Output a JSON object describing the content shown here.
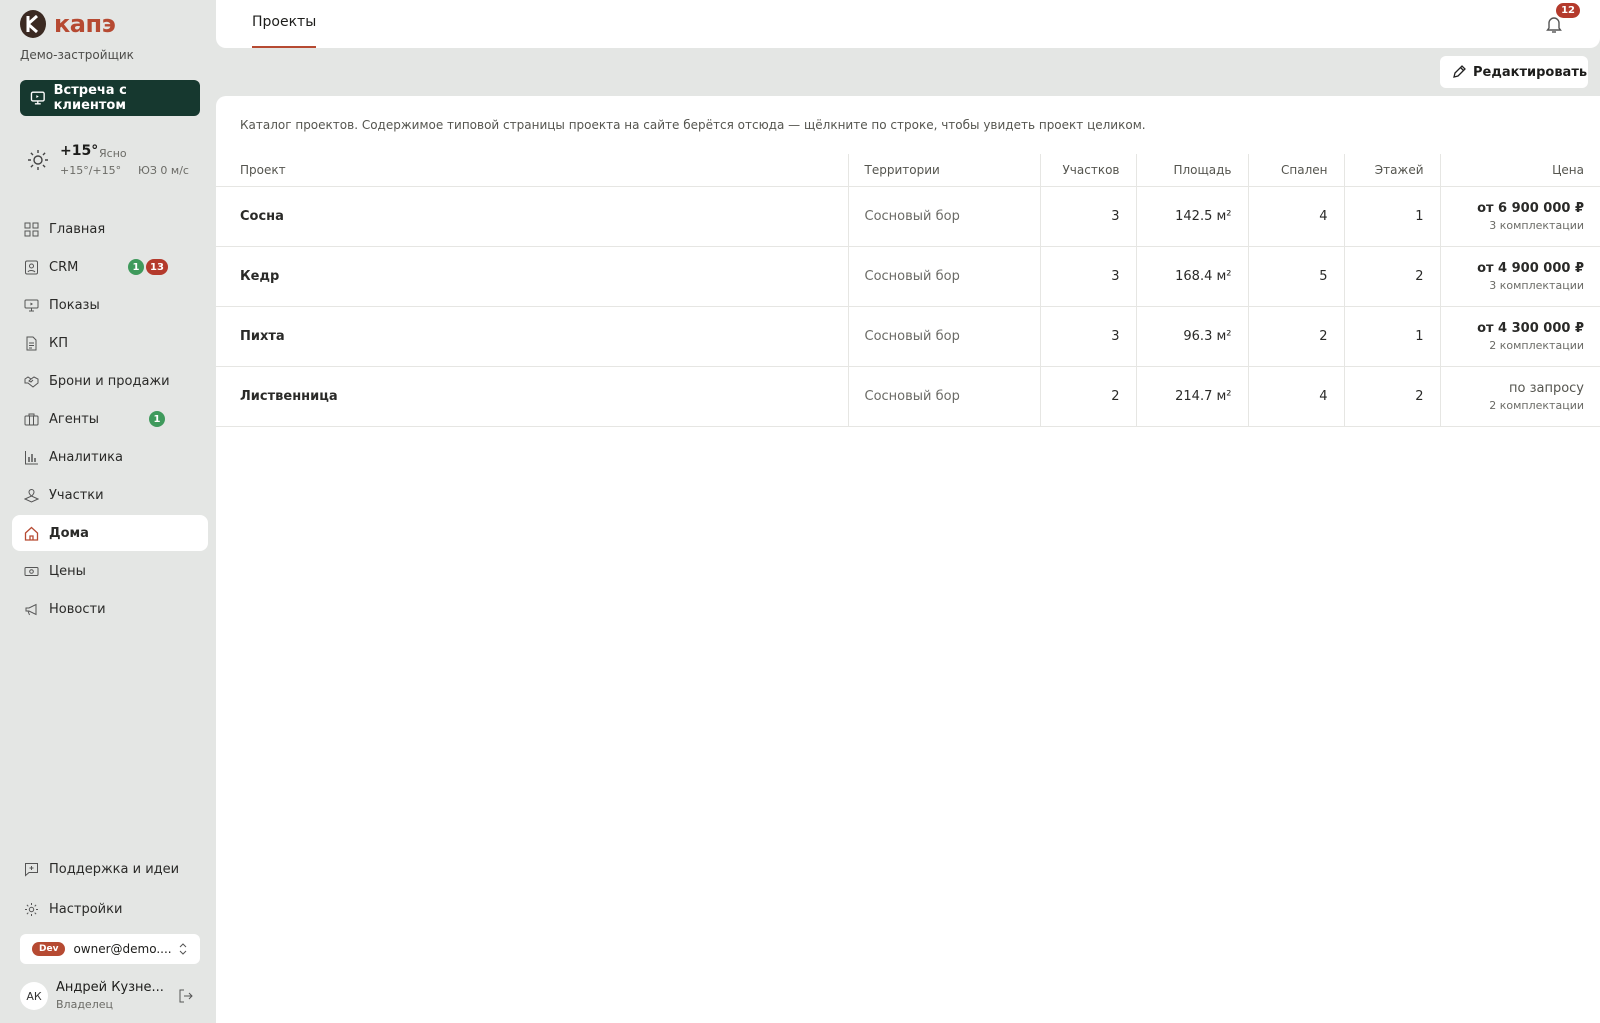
{
  "brand": {
    "name": "капэ",
    "subtitle": "Демо-застройщик",
    "accent": "#b64a32"
  },
  "meet_button": {
    "label": "Встреча с клиентом",
    "icon": "presentation-icon"
  },
  "weather": {
    "temp": "+15°",
    "condition": "Ясно",
    "range": "+15°/+15°",
    "wind": "ЮЗ 0 м/с",
    "icon": "sun-icon"
  },
  "sidebar": {
    "items": [
      {
        "label": "Главная",
        "icon": "grid-icon"
      },
      {
        "label": "CRM",
        "icon": "contact-card-icon",
        "badge_green": "1",
        "badge_red": "13"
      },
      {
        "label": "Показы",
        "icon": "monitor-icon"
      },
      {
        "label": "КП",
        "icon": "document-icon"
      },
      {
        "label": "Брони и продажи",
        "icon": "handshake-icon"
      },
      {
        "label": "Агенты",
        "icon": "briefcase-icon",
        "badge_green": "1"
      },
      {
        "label": "Аналитика",
        "icon": "bar-chart-icon"
      },
      {
        "label": "Участки",
        "icon": "map-pin-icon"
      },
      {
        "label": "Дома",
        "icon": "house-icon",
        "active": true
      },
      {
        "label": "Цены",
        "icon": "banknote-icon"
      },
      {
        "label": "Новости",
        "icon": "megaphone-icon"
      }
    ],
    "bottom": [
      {
        "label": "Поддержка и идеи",
        "icon": "message-plus-icon"
      },
      {
        "label": "Настройки",
        "icon": "gear-icon"
      }
    ]
  },
  "account": {
    "env": "Dev",
    "email": "owner@demo...."
  },
  "user": {
    "initials": "АК",
    "name": "Андрей Кузне...",
    "role": "Владелец"
  },
  "header": {
    "tab": "Проекты",
    "notifications": "12"
  },
  "edit_button": {
    "label": "Редактировать"
  },
  "description": "Каталог проектов. Содержимое типовой страницы проекта на сайте берётся отсюда — щёлкните по строке, чтобы увидеть проект целиком.",
  "table": {
    "columns": [
      "Проект",
      "Территории",
      "Участков",
      "Площадь",
      "Спален",
      "Этажей",
      "Цена"
    ],
    "rows": [
      {
        "name": "Сосна",
        "territory": "Сосновый бор",
        "plots": "3",
        "area": "142.5 м²",
        "bedrooms": "4",
        "floors": "1",
        "price": "от 6 900 000 ₽",
        "configs": "3 комплектации"
      },
      {
        "name": "Кедр",
        "territory": "Сосновый бор",
        "plots": "3",
        "area": "168.4 м²",
        "bedrooms": "5",
        "floors": "2",
        "price": "от 4 900 000 ₽",
        "configs": "3 комплектации"
      },
      {
        "name": "Пихта",
        "territory": "Сосновый бор",
        "plots": "3",
        "area": "96.3 м²",
        "bedrooms": "2",
        "floors": "1",
        "price": "от 4 300 000 ₽",
        "configs": "2 комплектации"
      },
      {
        "name": "Лиственница",
        "territory": "Сосновый бор",
        "plots": "2",
        "area": "214.7 м²",
        "bedrooms": "4",
        "floors": "2",
        "price": "по запросу",
        "configs": "2 комплектации"
      }
    ]
  }
}
